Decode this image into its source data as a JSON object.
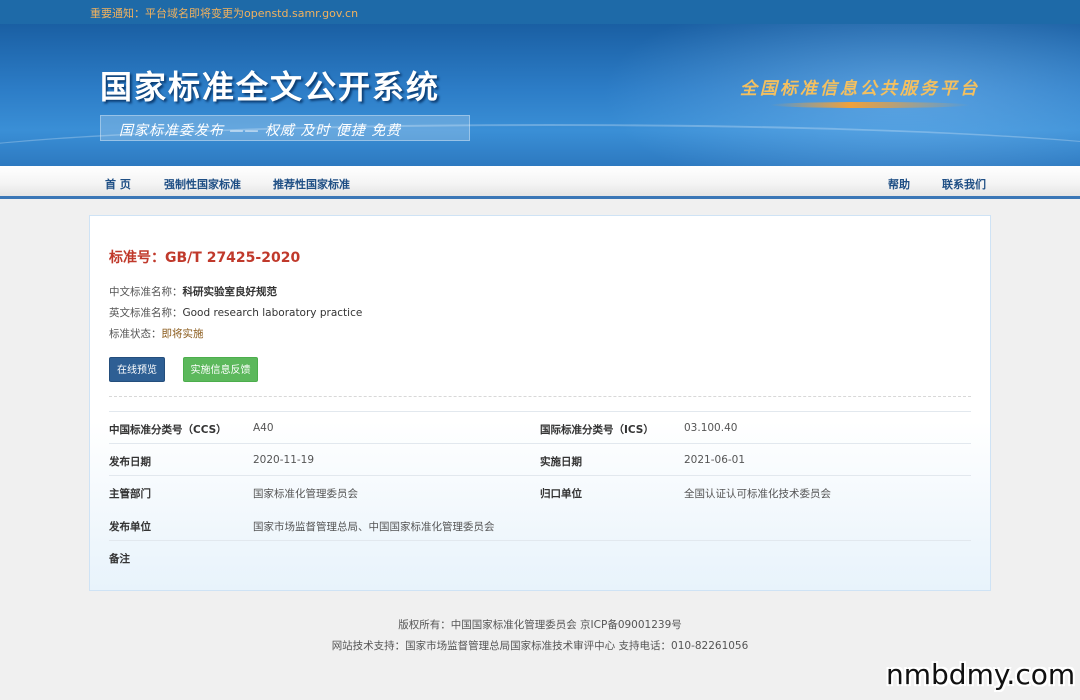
{
  "notice": {
    "text": "重要通知：平台域名即将变更为openstd.samr.gov.cn"
  },
  "header": {
    "title": "国家标准全文公开系统",
    "slogan": "国家标准委发布 —— 权威 及时 便捷 免费",
    "platform": "全国标准信息公共服务平台"
  },
  "nav": {
    "home": "首 页",
    "mandatory": "强制性国家标准",
    "recommended": "推荐性国家标准",
    "help": "帮助",
    "contact": "联系我们"
  },
  "standard": {
    "number_label": "标准号：",
    "number": "GB/T 27425-2020",
    "cn_name_label": "中文标准名称：",
    "cn_name": "科研实验室良好规范",
    "en_name_label": "英文标准名称：",
    "en_name": "Good research laboratory practice",
    "status_label": "标准状态：",
    "status": "即将实施"
  },
  "buttons": {
    "preview": "在线预览",
    "feedback": "实施信息反馈"
  },
  "details": {
    "ccs_label": "中国标准分类号（CCS）",
    "ccs": "A40",
    "ics_label": "国际标准分类号（ICS）",
    "ics": "03.100.40",
    "publish_date_label": "发布日期",
    "publish_date": "2020-11-19",
    "implement_date_label": "实施日期",
    "implement_date": "2021-06-01",
    "authority_label": "主管部门",
    "authority": "国家标准化管理委员会",
    "centralized_label": "归口单位",
    "centralized": "全国认证认可标准化技术委员会",
    "publisher_label": "发布单位",
    "publisher": "国家市场监督管理总局、中国国家标准化管理委员会",
    "remark_label": "备注",
    "remark": ""
  },
  "footer": {
    "copyright": "版权所有：中国国家标准化管理委员会 京ICP备09001239号",
    "support": "网站技术支持：国家市场监督管理总局国家标准技术审评中心 支持电话：010-82261056"
  },
  "watermark": "nmbdmy.com",
  "colors": {
    "brand_blue": "#2c7cc6",
    "title_red": "#c0392b",
    "button_blue": "#2e5f94",
    "button_green": "#5cb85c",
    "notice_orange": "#f2b25e"
  }
}
